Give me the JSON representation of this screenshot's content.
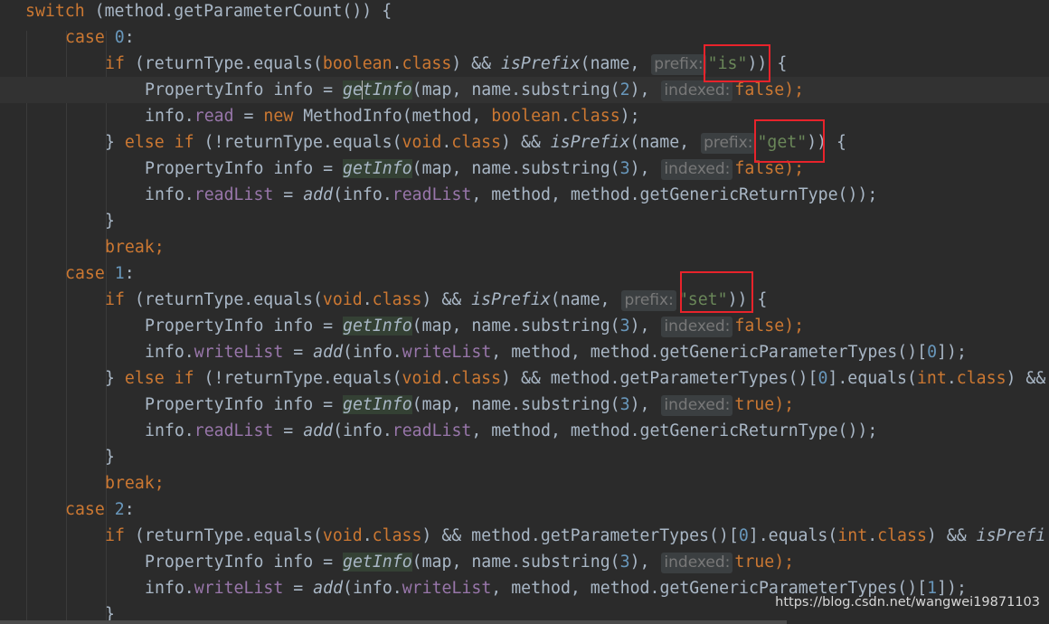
{
  "code": {
    "l1_kw_switch": "switch",
    "l1_rest": " (method.getParameterCount()) {",
    "case_kw": "case",
    "case0_num": "0",
    "case1_num": "1",
    "case2_num": "2",
    "colon": ":",
    "if_kw": "if",
    "else_kw": "else",
    "break_kw": "break",
    "new_kw": "new",
    "boolean_kw": "boolean",
    "void_kw": "void",
    "int_kw": "int",
    "class_kw": "class",
    "false_kw": "false",
    "true_kw": "true",
    "returnType_equals": "(returnType.equals(",
    "not_returnType_equals": "(!returnType.equals(",
    "dot": ".",
    "and_and": ") && ",
    "isPrefix": "isPrefix",
    "name_open": "(name, ",
    "close_paren_brace": ")) {",
    "str_is": "\"is\"",
    "str_get": "\"get\"",
    "str_set": "\"set\"",
    "property_info_decl": "PropertyInfo info = ",
    "getInfo": "getInfo",
    "map_name_substring": "(map, name.substring(",
    "num_2": "2",
    "num_3": "3",
    "paren_comma": "), ",
    "semi_end": ");",
    "info_dot": "info.",
    "read": "read",
    "readList": "readList",
    "writeList": "writeList",
    "assign": " = ",
    "method_info_rest": " MethodInfo(method, ",
    "add": "add",
    "info_open": "(info.",
    "method_generic_return": ", method, method.getGenericReturnType());",
    "method_generic_param_pre": ", method, method.getGenericParameterTypes()[",
    "idx_0": "0",
    "idx_1": "1",
    "bracket_end": "]);",
    "close_brace": "}",
    "else_if_line_mid": ") && method.getParameterTypes()[",
    "equals_open": "].equals(",
    "close_and": ") &&",
    "close_and_space": ") && ",
    "isPrefi": "isPrefi",
    "semicolon": ";",
    "brace_else": "} "
  },
  "hints": {
    "prefix": "prefix:",
    "indexed": "indexed:"
  },
  "watermark": "https://blog.csdn.net/wangwei19871103",
  "colors": {
    "background": "#2b2b2b",
    "keyword": "#cc7832",
    "number": "#6897bb",
    "string": "#6a8759",
    "field": "#9876aa",
    "text": "#a9b7c6",
    "highlight_box": "#e8232b"
  }
}
